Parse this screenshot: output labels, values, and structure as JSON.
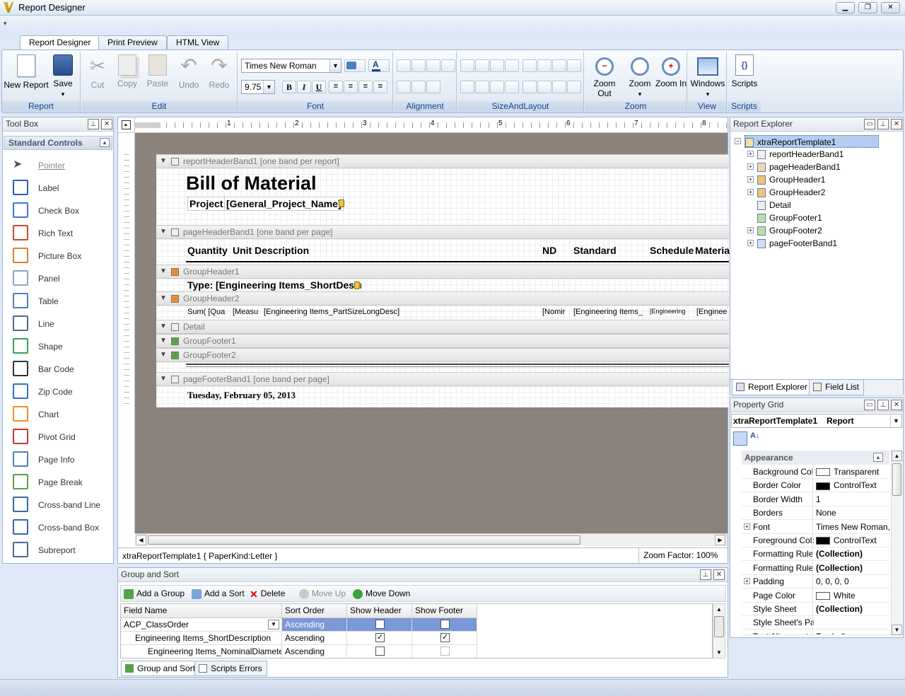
{
  "app": {
    "title": "Report Designer"
  },
  "window": {
    "min": "▁",
    "max": "❐",
    "close": "✕"
  },
  "tabs": [
    {
      "label": "Report Designer"
    },
    {
      "label": "Print Preview"
    },
    {
      "label": "HTML View"
    }
  ],
  "ribbon": {
    "report": {
      "group": "Report",
      "new": "New Report",
      "save": "Save"
    },
    "edit": {
      "group": "Edit",
      "cut": "Cut",
      "copy": "Copy",
      "paste": "Paste",
      "undo": "Undo",
      "redo": "Redo"
    },
    "font": {
      "group": "Font",
      "family": "Times New Roman",
      "size": "9.75",
      "bold": "B",
      "italic": "I",
      "underline": "U"
    },
    "alignment": {
      "group": "Alignment"
    },
    "sizeandlayout": {
      "group": "SizeAndLayout"
    },
    "zoom": {
      "group": "Zoom",
      "zoom_out": "Zoom Out",
      "zoom": "Zoom",
      "zoom_in": "Zoom In"
    },
    "view": {
      "group": "View",
      "windows": "Windows"
    },
    "scripts": {
      "group": "Scripts",
      "scripts": "Scripts"
    }
  },
  "toolbox": {
    "title": "Tool Box",
    "section": "Standard Controls",
    "items": [
      {
        "label": "Pointer",
        "icon": "pointer-icon"
      },
      {
        "label": "Label",
        "icon": "label-icon"
      },
      {
        "label": "Check Box",
        "icon": "checkbox-icon"
      },
      {
        "label": "Rich Text",
        "icon": "richtext-icon"
      },
      {
        "label": "Picture Box",
        "icon": "picture-icon"
      },
      {
        "label": "Panel",
        "icon": "panel-icon"
      },
      {
        "label": "Table",
        "icon": "table-icon"
      },
      {
        "label": "Line",
        "icon": "line-icon"
      },
      {
        "label": "Shape",
        "icon": "shape-icon"
      },
      {
        "label": "Bar Code",
        "icon": "barcode-icon"
      },
      {
        "label": "Zip Code",
        "icon": "zipcode-icon"
      },
      {
        "label": "Chart",
        "icon": "chart-icon"
      },
      {
        "label": "Pivot Grid",
        "icon": "pivotgrid-icon"
      },
      {
        "label": "Page Info",
        "icon": "pageinfo-icon"
      },
      {
        "label": "Page Break",
        "icon": "pagebreak-icon"
      },
      {
        "label": "Cross-band Line",
        "icon": "crossband-line-icon"
      },
      {
        "label": "Cross-band Box",
        "icon": "crossband-box-icon"
      },
      {
        "label": "Subreport",
        "icon": "subreport-icon"
      }
    ]
  },
  "ruler": {
    "ticks": [
      "1",
      "2",
      "3",
      "4",
      "5",
      "6",
      "7",
      "8"
    ]
  },
  "report": {
    "bands": {
      "report_header": "reportHeaderBand1 [one band per report]",
      "page_header": "pageHeaderBand1 [one band per page]",
      "group_header1": "GroupHeader1",
      "group_header2": "GroupHeader2",
      "detail": "Detail",
      "group_footer1": "GroupFooter1",
      "group_footer2": "GroupFooter2",
      "page_footer": "pageFooterBand1 [one band per page]"
    },
    "title": "Bill of Material",
    "project_label": "Project:",
    "project_field": "[General_Project_Name]",
    "columns": {
      "quantity": "Quantity",
      "unit_desc": "Unit Description",
      "nd": "ND",
      "standard": "Standard",
      "schedule": "Schedule",
      "material": "Materia"
    },
    "type_label": "Type:",
    "type_field": "[Engineering Items_ShortDescri",
    "gh2": {
      "sum": "Sum( [Qua",
      "meas": "[Measu",
      "part": "[Engineering Items_PartSizeLongDesc]",
      "nomi": "[Nomir",
      "ei1": "[Engineering Items_",
      "ei2": "[Engineering",
      "ei3": "[Enginee"
    },
    "date": "Tuesday, February 05, 2013"
  },
  "designer_status": {
    "left": "xtraReportTemplate1 { PaperKind:Letter }",
    "zoom": "Zoom Factor: 100%"
  },
  "explorer": {
    "title": "Report Explorer",
    "root": "xtraReportTemplate1",
    "nodes": [
      "reportHeaderBand1",
      "pageHeaderBand1",
      "GroupHeader1",
      "GroupHeader2",
      "Detail",
      "GroupFooter1",
      "GroupFooter2",
      "pageFooterBand1"
    ],
    "tab1": "Report Explorer",
    "tab2": "Field List"
  },
  "propgrid": {
    "title": "Property Grid",
    "object": "xtraReportTemplate1",
    "type": "Report",
    "category": "Appearance",
    "rows": [
      {
        "name": "Background Colo",
        "value": "Transparent"
      },
      {
        "name": "Border Color",
        "value": "ControlText"
      },
      {
        "name": "Border Width",
        "value": "1"
      },
      {
        "name": "Borders",
        "value": "None"
      },
      {
        "name": "Font",
        "value": "Times New Roman,..."
      },
      {
        "name": "Foreground Colo",
        "value": "ControlText"
      },
      {
        "name": "Formatting Rule",
        "value": "(Collection)"
      },
      {
        "name": "Formatting Rules",
        "value": "(Collection)"
      },
      {
        "name": "Padding",
        "value": "0, 0, 0, 0"
      },
      {
        "name": "Page Color",
        "value": "White"
      },
      {
        "name": "Style Sheet",
        "value": "(Collection)"
      },
      {
        "name": "Style Sheet's Pat",
        "value": ""
      },
      {
        "name": "Text Alignment",
        "value": "Top Left"
      }
    ]
  },
  "groupsort": {
    "title": "Group and Sort",
    "add_group": "Add a Group",
    "add_sort": "Add a Sort",
    "delete": "Delete",
    "move_up": "Move Up",
    "move_down": "Move Down",
    "headers": [
      "Field Name",
      "Sort Order",
      "Show Header",
      "Show Footer"
    ],
    "rows": [
      {
        "field": "ACP_ClassOrder",
        "order": "Ascending"
      },
      {
        "field": "Engineering Items_ShortDescription",
        "order": "Ascending"
      },
      {
        "field": "Engineering Items_NominalDiameter",
        "order": "Ascending"
      }
    ],
    "tab1": "Group and Sort",
    "tab2": "Scripts Errors"
  },
  "colors": {
    "accent": "#15428b",
    "selection": "#7b98d8",
    "canvas": "#8b837b"
  }
}
